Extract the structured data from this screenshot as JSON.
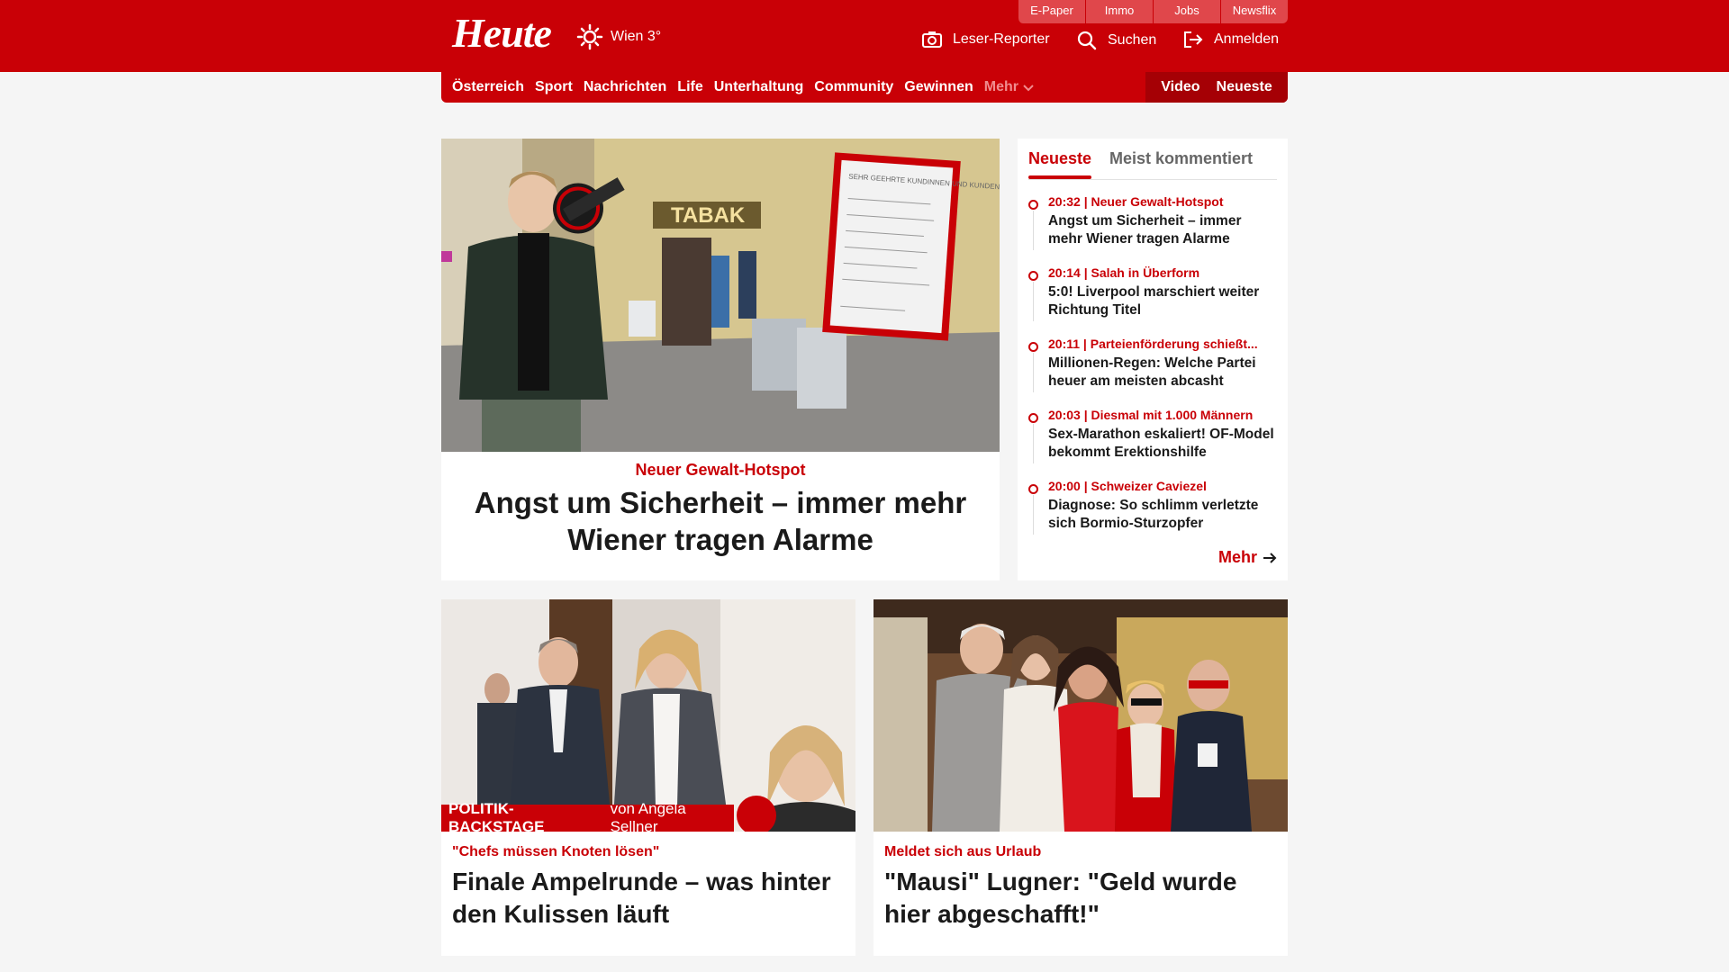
{
  "header": {
    "logo": "Heute",
    "weather": "Wien 3°",
    "service_tabs": [
      "E-Paper",
      "Immo",
      "Jobs",
      "Newsflix"
    ],
    "reporter": "Leser-Reporter",
    "search": "Suchen",
    "login": "Anmelden"
  },
  "nav": {
    "items": [
      "Österreich",
      "Sport",
      "Nachrichten",
      "Life",
      "Unterhaltung",
      "Community",
      "Gewinnen"
    ],
    "more": "Mehr",
    "video": "Video",
    "latest": "Neueste"
  },
  "hero": {
    "kicker": "Neuer Gewalt-Hotspot",
    "title": "Angst um Sicherheit – immer mehr Wiener tragen Alarme",
    "shop_sign": "TABAK",
    "note_text": "SEHR GEEHRTE KUNDINNEN UND KUNDEN"
  },
  "sidebar": {
    "tab_latest": "Neueste",
    "tab_commented": "Meist kommentiert",
    "items": [
      {
        "meta": "20:32 | Neuer Gewalt-Hotspot",
        "title": "Angst um Sicherheit – immer mehr Wiener tragen Alarme"
      },
      {
        "meta": "20:14 | Salah in Überform",
        "title": "5:0! Liverpool marschiert weiter Richtung Titel"
      },
      {
        "meta": "20:11 | Parteienförderung schießt...",
        "title": "Millionen-Regen: Welche Partei heuer am meisten abcasht"
      },
      {
        "meta": "20:03 | Diesmal mit 1.000 Männern",
        "title": "Sex-Marathon eskaliert! OF-Model bekommt Erektionshilfe"
      },
      {
        "meta": "20:00 | Schweizer Caviezel",
        "title": "Diagnose: So schlimm verletzte sich Bormio-Sturzopfer"
      }
    ],
    "more": "Mehr"
  },
  "cards": [
    {
      "kicker": "\"Chefs müssen Knoten lösen\"",
      "title": "Finale Ampelrunde – was hinter den Kulissen läuft",
      "badge_bold": "POLITIK-BACKSTAGE",
      "badge_rest": "von Angela Sellner"
    },
    {
      "kicker": "Meldet sich aus Urlaub",
      "title": "\"Mausi\" Lugner: \"Geld wurde hier abgeschafft!\""
    }
  ]
}
